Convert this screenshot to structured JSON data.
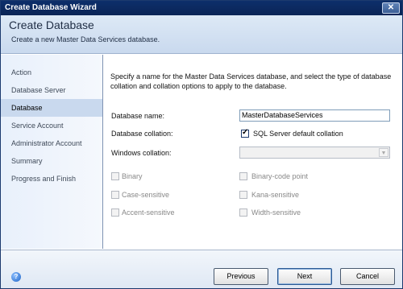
{
  "window": {
    "title": "Create Database Wizard",
    "close_glyph": "✕"
  },
  "header": {
    "title": "Create Database",
    "subtitle": "Create a new Master Data Services database."
  },
  "nav": {
    "items": [
      {
        "label": "Action"
      },
      {
        "label": "Database Server"
      },
      {
        "label": "Database"
      },
      {
        "label": "Service Account"
      },
      {
        "label": "Administrator Account"
      },
      {
        "label": "Summary"
      },
      {
        "label": "Progress and Finish"
      }
    ],
    "active": "Database"
  },
  "content": {
    "intro": "Specify a name for the Master Data Services database, and select the type of database collation and collation options to apply to the database.",
    "database_name_label": "Database name:",
    "database_name_value": "MasterDatabaseServices",
    "database_collation_label": "Database collation:",
    "sql_default_collation_label": "SQL Server default collation",
    "sql_default_collation_checked": true,
    "windows_collation_label": "Windows collation:",
    "windows_collation_value": "",
    "options": {
      "binary": "Binary",
      "binary_code_point": "Binary-code point",
      "case_sensitive": "Case-sensitive",
      "kana_sensitive": "Kana-sensitive",
      "accent_sensitive": "Accent-sensitive",
      "width_sensitive": "Width-sensitive"
    }
  },
  "footer": {
    "help_glyph": "?",
    "previous_label": "Previous",
    "next_label": "Next",
    "cancel_label": "Cancel"
  }
}
